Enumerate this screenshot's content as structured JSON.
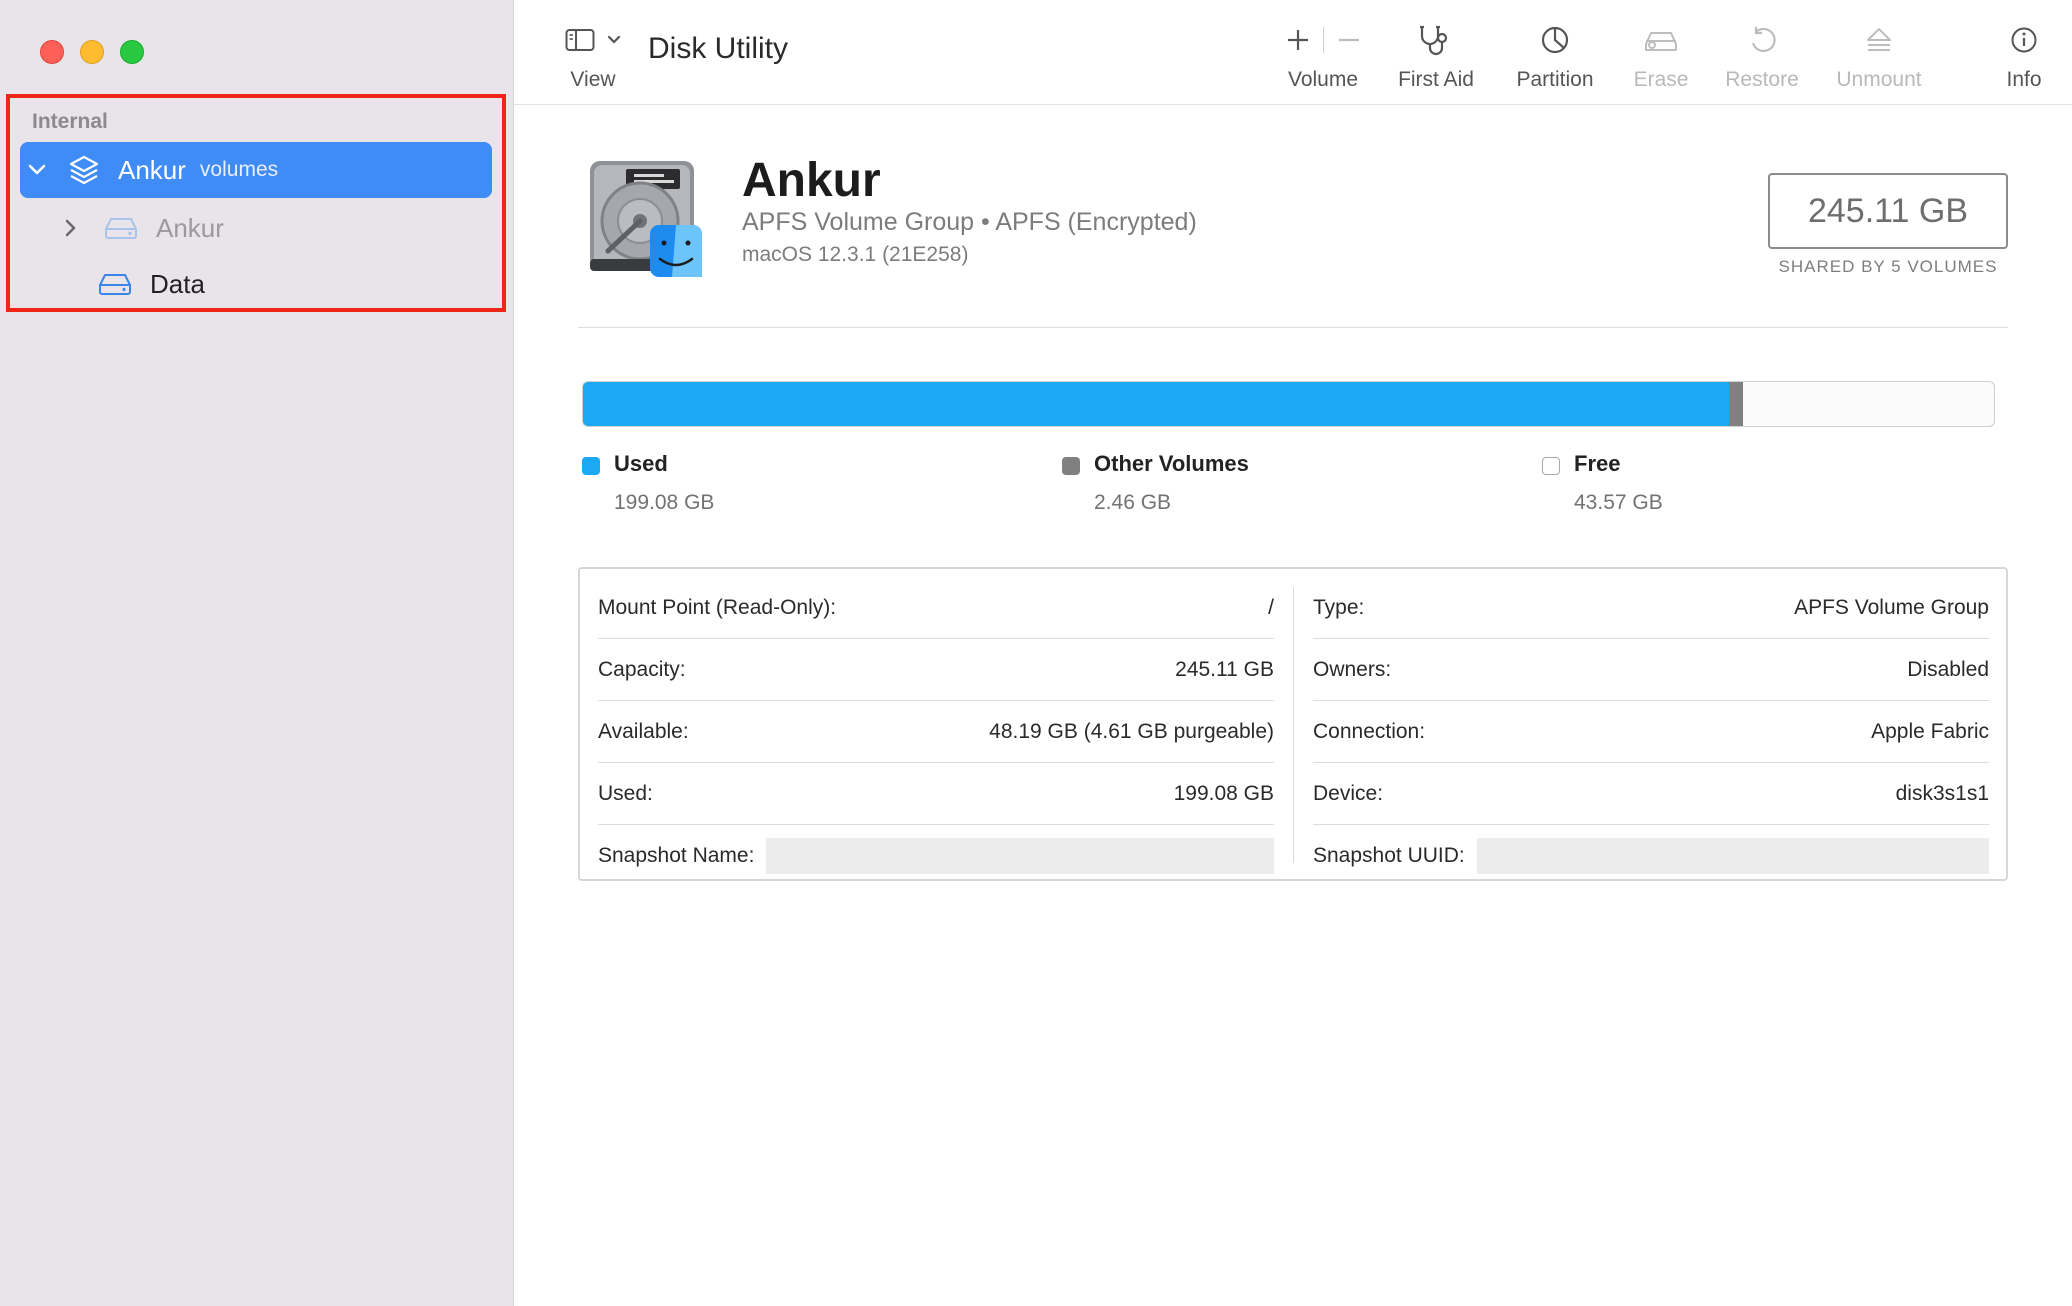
{
  "window": {
    "title": "Disk Utility"
  },
  "sidebar": {
    "section": "Internal",
    "items": [
      {
        "label": "Ankur",
        "sublabel": "volumes"
      },
      {
        "label": "Ankur"
      },
      {
        "label": "Data"
      }
    ]
  },
  "toolbar": {
    "view_label": "View",
    "volume_label": "Volume",
    "first_aid_label": "First Aid",
    "partition_label": "Partition",
    "erase_label": "Erase",
    "restore_label": "Restore",
    "unmount_label": "Unmount",
    "info_label": "Info"
  },
  "volume": {
    "name": "Ankur",
    "subtitle": "APFS Volume Group • APFS (Encrypted)",
    "os": "macOS 12.3.1 (21E258)",
    "size": "245.11 GB",
    "shared_caption": "SHARED BY 5 VOLUMES"
  },
  "usage": {
    "used_fraction": 0.8122,
    "other_fraction": 0.01,
    "used": {
      "label": "Used",
      "value": "199.08 GB",
      "color": "#1aa9f2"
    },
    "other": {
      "label": "Other Volumes",
      "value": "2.46 GB",
      "color": "#808080"
    },
    "free": {
      "label": "Free",
      "value": "43.57 GB",
      "color": "#ffffff"
    }
  },
  "info": {
    "left": [
      {
        "label": "Mount Point (Read-Only):",
        "value": "/"
      },
      {
        "label": "Capacity:",
        "value": "245.11 GB"
      },
      {
        "label": "Available:",
        "value": "48.19 GB (4.61 GB purgeable)"
      },
      {
        "label": "Used:",
        "value": "199.08 GB"
      },
      {
        "label": "Snapshot Name:",
        "value": ""
      }
    ],
    "right": [
      {
        "label": "Type:",
        "value": "APFS Volume Group"
      },
      {
        "label": "Owners:",
        "value": "Disabled"
      },
      {
        "label": "Connection:",
        "value": "Apple Fabric"
      },
      {
        "label": "Device:",
        "value": "disk3s1s1"
      },
      {
        "label": "Snapshot UUID:",
        "value": ""
      }
    ]
  },
  "icons": {
    "view": "sidebar-toggle-icon",
    "volume_add": "plus-icon",
    "volume_remove": "minus-icon",
    "first_aid": "stethoscope-icon",
    "partition": "pie-chart-icon",
    "erase": "car-eraser-icon",
    "restore": "restore-arrow-icon",
    "unmount": "eject-icon",
    "info": "info-circle-icon"
  }
}
